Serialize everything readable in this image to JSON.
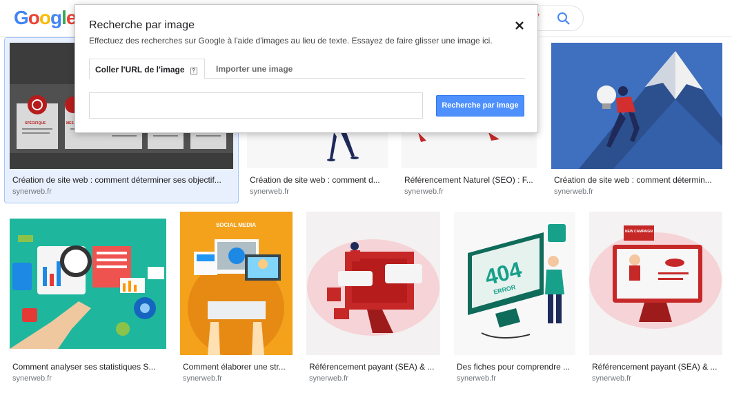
{
  "header": {
    "logo_letters": [
      "G",
      "o",
      "o",
      "g",
      "l",
      "e"
    ],
    "search_icon": "search-icon",
    "camera_icon": "camera-icon"
  },
  "dialog": {
    "title": "Recherche par image",
    "description": "Effectuez des recherches sur Google à l'aide d'images au lieu de texte. Essayez de faire glisser une image ici.",
    "tabs": [
      {
        "label": "Coller l'URL de l'image",
        "active": true
      },
      {
        "label": "Importer une image",
        "active": false
      }
    ],
    "url_input": {
      "value": "",
      "placeholder": ""
    },
    "search_button": "Recherche par image",
    "close_icon": "close-icon"
  },
  "thumb_texts": {
    "social_media": "SOCIAL MEDIA",
    "error_404": "404",
    "error_word": "ERROR",
    "new_campaign": "NEW CAMPAIGN",
    "specifique": "SPÉCIFIQUE",
    "mesurable": "MES"
  },
  "results": [
    {
      "title": "Création de site web : comment déterminer ses objectif...",
      "source": "synerweb.fr",
      "selected": true
    },
    {
      "title": "Création de site web : comment d...",
      "source": "synerweb.fr"
    },
    {
      "title": "Référencement Naturel (SEO) : F...",
      "source": "synerweb.fr"
    },
    {
      "title": "Création de site web : comment détermin...",
      "source": "synerweb.fr"
    },
    {
      "title": "Comment analyser ses statistiques S...",
      "source": "synerweb.fr"
    },
    {
      "title": "Comment élaborer une str...",
      "source": "synerweb.fr"
    },
    {
      "title": "Référencement payant (SEA) & ...",
      "source": "synerweb.fr"
    },
    {
      "title": "Des fiches pour comprendre ...",
      "source": "synerweb.fr"
    },
    {
      "title": "Référencement payant (SEA) & ...",
      "source": "synerweb.fr"
    }
  ],
  "colors": {
    "accent_blue": "#4d90fe",
    "selected_bg": "#e8f0fe"
  }
}
